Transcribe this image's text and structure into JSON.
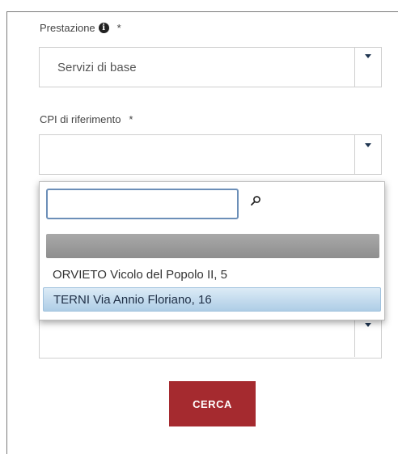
{
  "form": {
    "prestazione_label": "Prestazione",
    "prestazione_required": "*",
    "prestazione_value": "Servizi di base",
    "cpi_label": "CPI di riferimento",
    "cpi_required": "*",
    "cpi_value": "",
    "third_select_value": "",
    "submit_label": "CERCA"
  },
  "dropdown": {
    "search_value": "",
    "options": [
      {
        "label": ""
      },
      {
        "label": "ORVIETO Vicolo del Popolo II, 5"
      },
      {
        "label": "TERNI Via Annio Floriano, 16"
      }
    ],
    "highlighted_index": 2
  },
  "icons": {
    "info": "info-circle-icon",
    "search": "search-icon",
    "chevron": "chevron-down-icon"
  },
  "colors": {
    "submit_bg": "#a52a2f",
    "highlight_bg": "#aecde6",
    "search_border": "#6c8fb8"
  }
}
